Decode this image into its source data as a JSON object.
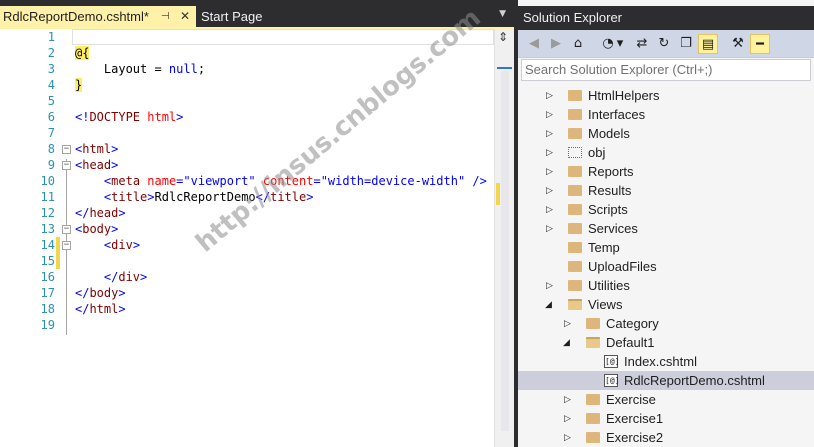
{
  "tabs": {
    "active": {
      "label": "RdlcReportDemo.cshtml*",
      "pin_icon": "pin-icon",
      "close_icon": "close-icon"
    },
    "inactive": {
      "label": "Start Page"
    },
    "dropdown_icon": "chevron-down-icon"
  },
  "editor": {
    "lines": [
      {
        "n": "1"
      },
      {
        "n": "2"
      },
      {
        "n": "3"
      },
      {
        "n": "4"
      },
      {
        "n": "5"
      },
      {
        "n": "6"
      },
      {
        "n": "7"
      },
      {
        "n": "8"
      },
      {
        "n": "9"
      },
      {
        "n": "10"
      },
      {
        "n": "11"
      },
      {
        "n": "12"
      },
      {
        "n": "13"
      },
      {
        "n": "14"
      },
      {
        "n": "15"
      },
      {
        "n": "16"
      },
      {
        "n": "17"
      },
      {
        "n": "18"
      },
      {
        "n": "19"
      }
    ],
    "code": {
      "l2_at": "@",
      "l2_brace": "{",
      "l3_text": "    Layout = ",
      "l3_null": "null",
      "l3_semi": ";",
      "l4_brace": "}",
      "l6_open": "<!",
      "l6_doctype": "DOCTYPE",
      "l6_html": " html",
      "l6_close": ">",
      "l8_open": "<",
      "l8_tag": "html",
      "l8_close": ">",
      "l9_open": "<",
      "l9_tag": "head",
      "l9_close": ">",
      "l10_indent": "    ",
      "l10_open": "<",
      "l10_tag": "meta",
      "l10_attr1": " name",
      "l10_eq1": "=",
      "l10_val1": "\"viewport\"",
      "l10_attr2": " content",
      "l10_eq2": "=",
      "l10_val2": "\"width=device-width\"",
      "l10_close": " />",
      "l11_indent": "    ",
      "l11_open": "<",
      "l11_tag": "title",
      "l11_gt": ">",
      "l11_text": "RdlcReportDemo",
      "l11_end_open": "</",
      "l11_end_tag": "title",
      "l11_end_close": ">",
      "l12_open": "</",
      "l12_tag": "head",
      "l12_close": ">",
      "l13_open": "<",
      "l13_tag": "body",
      "l13_close": ">",
      "l14_indent": "    ",
      "l14_open": "<",
      "l14_tag": "div",
      "l14_close": ">",
      "l16_indent": "    ",
      "l16_open": "</",
      "l16_tag": "div",
      "l16_close": ">",
      "l17_open": "</",
      "l17_tag": "body",
      "l17_close": ">",
      "l18_open": "</",
      "l18_tag": "html",
      "l18_close": ">"
    },
    "split_icon": "split-icon"
  },
  "solution_explorer": {
    "title": "Solution Explorer",
    "search_placeholder": "Search Solution Explorer (Ctrl+;)",
    "toolbar": [
      {
        "icon": "back-icon",
        "glyph": "◀"
      },
      {
        "icon": "forward-icon",
        "glyph": "▶"
      },
      {
        "icon": "home-icon",
        "glyph": "⌂"
      },
      {
        "icon": "history-icon",
        "glyph": "◔"
      },
      {
        "icon": "history-dropdown-icon",
        "glyph": "▾"
      },
      {
        "icon": "sync-icon",
        "glyph": "⇄"
      },
      {
        "icon": "refresh-icon",
        "glyph": "↻"
      },
      {
        "icon": "collapse-all-icon",
        "glyph": "❐"
      },
      {
        "icon": "show-all-files-icon",
        "glyph": "▤"
      },
      {
        "icon": "properties-icon",
        "glyph": "🔧"
      },
      {
        "icon": "preview-icon",
        "glyph": "━"
      }
    ],
    "tree": [
      {
        "label": "HtmlHelpers",
        "depth": 0,
        "expand": "collapsed",
        "icon": "folder-icon"
      },
      {
        "label": "Interfaces",
        "depth": 0,
        "expand": "collapsed",
        "icon": "folder-icon"
      },
      {
        "label": "Models",
        "depth": 0,
        "expand": "collapsed",
        "icon": "folder-icon"
      },
      {
        "label": "obj",
        "depth": 0,
        "expand": "collapsed",
        "icon": "hidden-folder-icon"
      },
      {
        "label": "Reports",
        "depth": 0,
        "expand": "collapsed",
        "icon": "folder-icon"
      },
      {
        "label": "Results",
        "depth": 0,
        "expand": "collapsed",
        "icon": "folder-icon"
      },
      {
        "label": "Scripts",
        "depth": 0,
        "expand": "collapsed",
        "icon": "folder-icon"
      },
      {
        "label": "Services",
        "depth": 0,
        "expand": "collapsed",
        "icon": "folder-icon"
      },
      {
        "label": "Temp",
        "depth": 0,
        "expand": "none",
        "icon": "folder-icon"
      },
      {
        "label": "UploadFiles",
        "depth": 0,
        "expand": "none",
        "icon": "folder-icon"
      },
      {
        "label": "Utilities",
        "depth": 0,
        "expand": "collapsed",
        "icon": "folder-icon"
      },
      {
        "label": "Views",
        "depth": 0,
        "expand": "expanded",
        "icon": "open-folder-icon"
      },
      {
        "label": "Category",
        "depth": 1,
        "expand": "collapsed",
        "icon": "folder-icon"
      },
      {
        "label": "Default1",
        "depth": 1,
        "expand": "expanded",
        "icon": "open-folder-icon"
      },
      {
        "label": "Index.cshtml",
        "depth": 2,
        "expand": "none",
        "icon": "razor-file-icon"
      },
      {
        "label": "RdlcReportDemo.cshtml",
        "depth": 2,
        "expand": "none",
        "icon": "razor-file-icon",
        "selected": true
      },
      {
        "label": "Exercise",
        "depth": 1,
        "expand": "collapsed",
        "icon": "folder-icon"
      },
      {
        "label": "Exercise1",
        "depth": 1,
        "expand": "collapsed",
        "icon": "folder-icon"
      },
      {
        "label": "Exercise2",
        "depth": 1,
        "expand": "collapsed",
        "icon": "folder-icon"
      }
    ],
    "file_icon_glyph": "[@]"
  },
  "watermark": "http://insus.cnblogs.com"
}
